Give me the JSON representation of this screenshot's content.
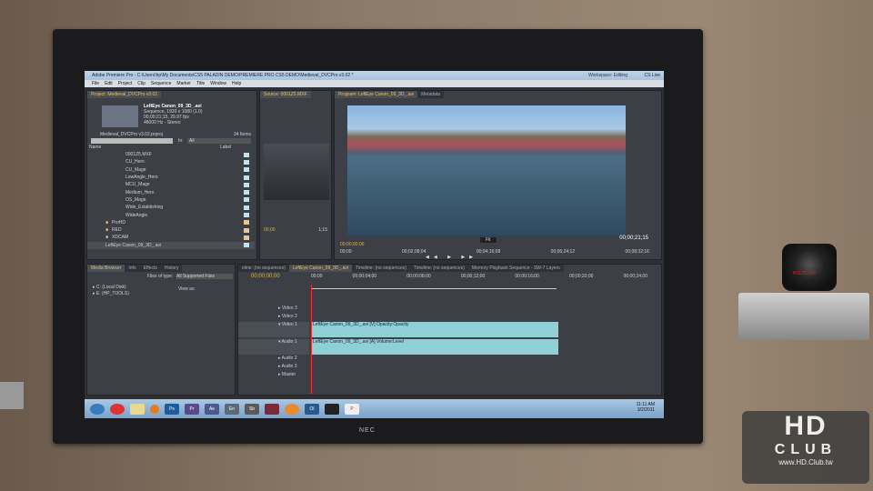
{
  "window": {
    "title": "Adobe Premiere Pro - C:\\Users\\hp\\My Documents\\CS5 PALADIN DEMO\\PREMIERE PRO CS5 DEMO\\Medieval_DVCPro v3.02 *",
    "workspace_label": "Workspace:",
    "workspace": "Editing",
    "cs_live": "CS Live"
  },
  "menu": [
    "File",
    "Edit",
    "Project",
    "Clip",
    "Sequence",
    "Marker",
    "Title",
    "Window",
    "Help"
  ],
  "project": {
    "tab": "Project: Medieval_DVCPro v3.02",
    "clip_name": "LeftEye Canon_09_3D_.avi",
    "info1": "Sequence, 1920 x 1080 (1.0)",
    "info2": "00;00;21;15, 29.97 fps",
    "info3": "48000 Hz - Stereo",
    "file": "Medieval_DVCPro v3.02.prproj",
    "count": "34 Items",
    "in_label": "In:",
    "in_value": "All",
    "col_name": "Name",
    "col_label": "Label",
    "items": [
      "0001Z5.MXF",
      "CU_Hero",
      "CU_Mage",
      "LowAngle_Hero",
      "MCU_Mage",
      "Medium_Hero",
      "OS_Mage",
      "Wide_Establishing",
      "WideAngle",
      "ProHD",
      "RED",
      "XDCAM",
      "LeftEye Canon_09_3D_.avi"
    ]
  },
  "source": {
    "tab": "Source: 0001Z5.MXF",
    "timecode": "00;00",
    "end": "1;15"
  },
  "program": {
    "tab": "Program: LeftEye Canon_09_3D_.avi",
    "metadata_tab": "Metadata",
    "timecode": "00;00;00;00",
    "duration": "00;00;21;15",
    "fit": "Fit",
    "ruler": [
      "00;00",
      "00;02;08;04",
      "00;04;16;08",
      "00;06;24;12",
      "00;08;32;16"
    ]
  },
  "media": {
    "tabs": [
      "Media Browser",
      "Info",
      "Effects",
      "History"
    ],
    "files_of_type": "Files of type:",
    "filter": "All Supported Files",
    "view_as": "View as:",
    "drives": [
      "C: (Local Disk)",
      "E: (HP_TOOLS)"
    ]
  },
  "timeline": {
    "tabs": [
      "eline: (no sequences)",
      "LeftEye Canon_09_3D_.avi",
      "Timeline: (no sequences)",
      "Timeline: (no sequences)",
      "Memory Playback Sequence - SW-7 Layers"
    ],
    "timecode": "00;00;00;00",
    "ruler": [
      "00;00",
      "00;00;04;00",
      "00;00;08;00",
      "00;00;12;00",
      "00;00;16;00",
      "00;00;20;00",
      "00;00;24;00"
    ],
    "tracks": [
      "Video 3",
      "Video 2",
      "Video 1",
      "Audio 1",
      "Audio 2",
      "Audio 3",
      "Master"
    ],
    "video_clip": "LeftEye Canon_09_3D_.avi [V]  Opacity:Opacity",
    "audio_clip": "LeftEye Canon_09_3D_.avi [A]  Volume:Level"
  },
  "taskbar": {
    "apps": [
      "Ps",
      "Pr",
      "Ae",
      "En",
      "Sb",
      "Ol"
    ],
    "time": "11:11 AM",
    "date": "3/2/2011"
  },
  "tv_brand": "NEC",
  "camera_brand": "POLYCOM",
  "watermark": {
    "big": "HD",
    "mid": "CLUB",
    "url": "www.HD.Club.tw"
  }
}
